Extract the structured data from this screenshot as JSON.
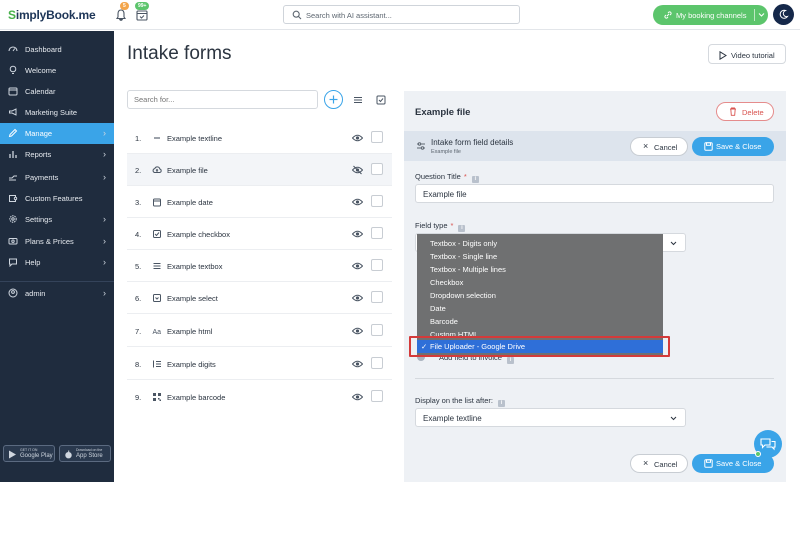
{
  "header": {
    "logo_prefix": "S",
    "logo_text": "implyBook.me",
    "notif_badge": "5",
    "calendar_badge": "99+",
    "search_placeholder": "Search with AI assistant...",
    "channels_label": "My booking channels"
  },
  "sidebar": {
    "items": [
      {
        "label": "Dashboard",
        "icon": "dashboard-icon"
      },
      {
        "label": "Welcome",
        "icon": "bulb-icon"
      },
      {
        "label": "Calendar",
        "icon": "calendar-icon"
      },
      {
        "label": "Marketing Suite",
        "icon": "megaphone-icon"
      },
      {
        "label": "Manage",
        "icon": "pencil-icon"
      },
      {
        "label": "Reports",
        "icon": "chart-icon"
      },
      {
        "label": "Payments",
        "icon": "payments-icon"
      },
      {
        "label": "Custom Features",
        "icon": "puzzle-icon"
      },
      {
        "label": "Settings",
        "icon": "gear-icon"
      },
      {
        "label": "Plans & Prices",
        "icon": "plans-icon"
      },
      {
        "label": "Help",
        "icon": "help-icon"
      }
    ],
    "user": "admin",
    "google_play_small": "GET IT ON",
    "google_play": "Google Play",
    "app_store_small": "Download on the",
    "app_store": "App Store"
  },
  "page": {
    "title": "Intake forms",
    "video_tutorial": "Video tutorial"
  },
  "list": {
    "search_placeholder": "Search for...",
    "rows": [
      {
        "num": "1.",
        "name": "Example textline",
        "icon": "dash-icon"
      },
      {
        "num": "2.",
        "name": "Example file",
        "icon": "cloud-upload-icon"
      },
      {
        "num": "3.",
        "name": "Example date",
        "icon": "calendar-icon"
      },
      {
        "num": "4.",
        "name": "Example checkbox",
        "icon": "checkbox-icon"
      },
      {
        "num": "5.",
        "name": "Example textbox",
        "icon": "lines-icon"
      },
      {
        "num": "6.",
        "name": "Example select",
        "icon": "select-icon"
      },
      {
        "num": "7.",
        "name": "Example html",
        "icon": "font-icon"
      },
      {
        "num": "8.",
        "name": "Example digits",
        "icon": "list-numbered-icon"
      },
      {
        "num": "9.",
        "name": "Example barcode",
        "icon": "qr-icon"
      }
    ]
  },
  "editor": {
    "title": "Example file",
    "delete_label": "Delete",
    "details_title": "Intake form field details",
    "details_subtitle": "Example file",
    "cancel_label": "Cancel",
    "save_label": "Save & Close",
    "question_title_label": "Question Title",
    "question_title_value": "Example file",
    "field_type_label": "Field type",
    "add_invoice_label": "Add field to invoice",
    "display_after_label": "Display on the list after:",
    "display_after_value": "Example textline",
    "field_type_options": [
      "Textbox - Digits only",
      "Textbox - Single line",
      "Textbox - Multiple lines",
      "Checkbox",
      "Dropdown selection",
      "Date",
      "Barcode",
      "Custom HTML",
      "File Uploader - Google Drive"
    ],
    "selected_check": "✓"
  },
  "colors": {
    "accent": "#3aa4e8",
    "sidebar_bg": "#1f2c3e",
    "green": "#5cc56c",
    "danger": "#d9534f",
    "highlight": "#d43a3a"
  }
}
